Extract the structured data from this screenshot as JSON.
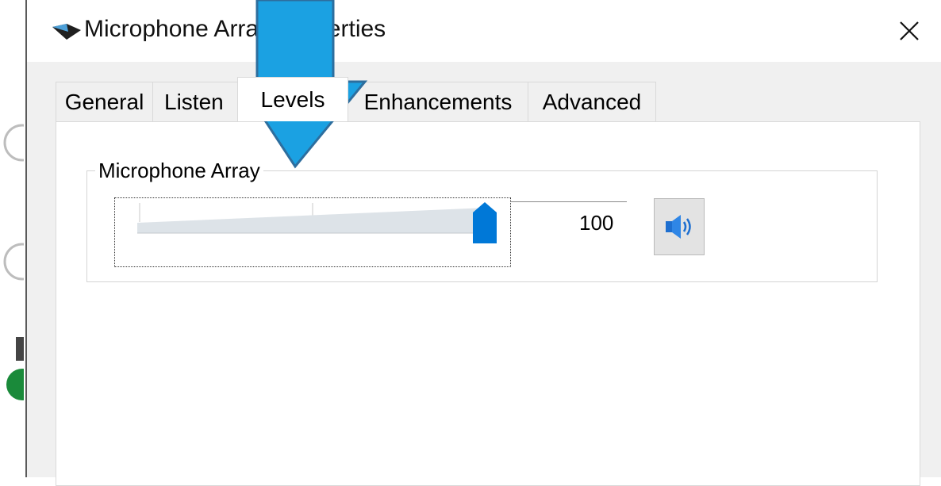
{
  "window": {
    "title": "Microphone Array Properties"
  },
  "tabs": [
    {
      "label": "General",
      "active": false
    },
    {
      "label": "Listen",
      "active": false
    },
    {
      "label": "Levels",
      "active": true
    },
    {
      "label": "Enhancements",
      "active": false
    },
    {
      "label": "Advanced",
      "active": false
    }
  ],
  "levels": {
    "group_label": "Microphone Array",
    "volume_value": "100",
    "volume_fraction": 1.0,
    "mute_icon": "speaker-icon"
  },
  "colors": {
    "accent": "#0078d7",
    "arrow": "#1ba1e2",
    "arrow_outline": "#2d6e9e"
  }
}
